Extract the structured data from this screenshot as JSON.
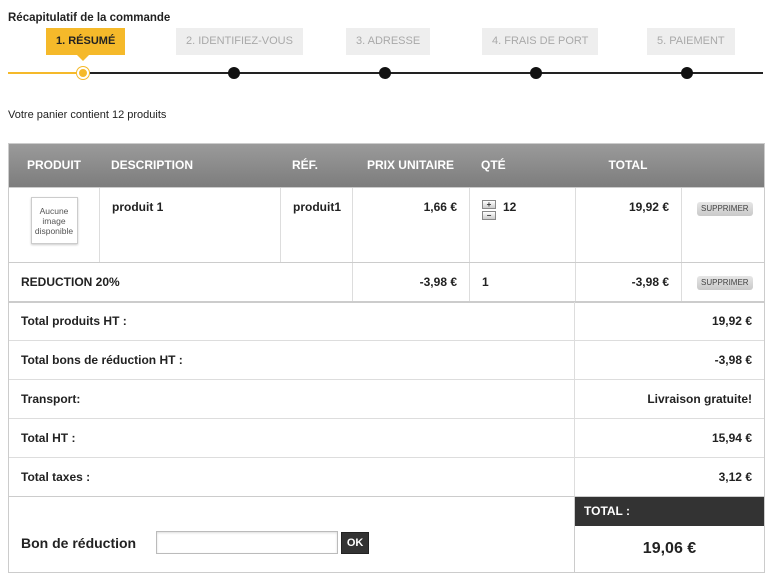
{
  "page_title": "Récapitulatif de la commande",
  "steps": [
    {
      "label": "1. Résumé",
      "active": true
    },
    {
      "label": "2. Identifiez-vous",
      "active": false
    },
    {
      "label": "3. Adresse",
      "active": false
    },
    {
      "label": "4. Frais de port",
      "active": false
    },
    {
      "label": "5. Paiement",
      "active": false
    }
  ],
  "cart_count": "Votre panier contient 12 produits",
  "table": {
    "headers": {
      "product": "Produit",
      "description": "Description",
      "ref": "Réf.",
      "unit_price": "Prix unitaire",
      "qty": "Qté",
      "total": "Total"
    },
    "product_row": {
      "no_image": "Aucune image disponible",
      "description": "produit 1",
      "ref": "produit1",
      "unit_price": "1,66 €",
      "qty_plus": "+",
      "qty_minus": "−",
      "qty": "12",
      "total": "19,92 €",
      "delete": "Supprimer"
    },
    "discount_row": {
      "label": "REDUCTION 20%",
      "unit_price": "-3,98 €",
      "qty": "1",
      "total": "-3,98 €",
      "delete": "Supprimer"
    }
  },
  "summary": [
    {
      "label": "Total produits HT :",
      "value": "19,92 €"
    },
    {
      "label": "Total bons de réduction HT :",
      "value": "-3,98 €"
    },
    {
      "label": "Transport:",
      "value": "Livraison gratuite!"
    },
    {
      "label": "Total HT :",
      "value": "15,94 €"
    },
    {
      "label": "Total taxes :",
      "value": "3,12 €"
    }
  ],
  "voucher": {
    "label": "Bon de réduction",
    "input_value": "",
    "ok_label": "OK"
  },
  "grand_total": {
    "label": "TOTAL :",
    "value": "19,06 €"
  },
  "colors": {
    "accent": "#f5b92a",
    "header_gray": "#8a8a8a",
    "dark": "#333333"
  }
}
